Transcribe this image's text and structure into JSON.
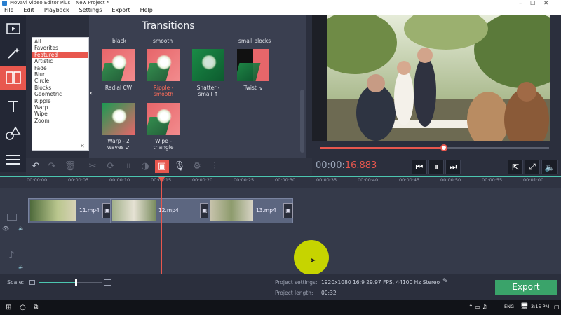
{
  "window": {
    "title": "Movavi Video Editor Plus – New Project *"
  },
  "menu": [
    "File",
    "Edit",
    "Playback",
    "Settings",
    "Export",
    "Help"
  ],
  "tools": [
    {
      "icon": "video-import-icon"
    },
    {
      "icon": "magic-wand-icon"
    },
    {
      "icon": "transitions-icon",
      "active": true
    },
    {
      "icon": "text-icon"
    },
    {
      "icon": "shapes-icon"
    },
    {
      "icon": "list-icon"
    }
  ],
  "transitions": {
    "title": "Transitions",
    "categories": [
      "All",
      "Favorites",
      "Featured",
      "Artistic",
      "Fade",
      "Blur",
      "Circle",
      "Blocks",
      "Geometric",
      "Ripple",
      "Warp",
      "Wipe",
      "Zoom"
    ],
    "selected_category": "Featured",
    "column_headers": [
      "black",
      "smooth",
      "",
      "small blocks"
    ],
    "items": [
      {
        "label": "Radial CW",
        "selected": false
      },
      {
        "label": "Ripple -\nsmooth",
        "selected": true
      },
      {
        "label": "Shatter -\nsmall ↑",
        "selected": false
      },
      {
        "label": "Twist ↘",
        "selected": false
      },
      {
        "label": "Warp - 2\nwaves ↙",
        "selected": false
      },
      {
        "label": "Wipe -\ntriangle",
        "selected": false
      }
    ]
  },
  "player": {
    "timecode_main": "00:00:",
    "timecode_frac": "16.883",
    "progress": 0.54
  },
  "timeline": {
    "ticks": [
      "00:00:00",
      "00:00:05",
      "00:00:10",
      "00:00:15",
      "00:00:20",
      "00:00:25",
      "00:00:30",
      "00:00:35",
      "00:00:40",
      "00:00:45",
      "00:00:50",
      "00:00:55",
      "00:01:00"
    ],
    "clips": [
      {
        "name": "11.mp4"
      },
      {
        "name": "12.mp4"
      },
      {
        "name": "13.mp4"
      }
    ]
  },
  "bottom": {
    "scale_label": "Scale:",
    "settings_label": "Project settings:",
    "settings_value": "1920x1080 16:9 29.97 FPS, 44100 Hz Stereo",
    "length_label": "Project length:",
    "length_value": "00:32",
    "export_label": "Export"
  },
  "taskbar": {
    "language": "ENG",
    "time": "3:15 PM"
  }
}
